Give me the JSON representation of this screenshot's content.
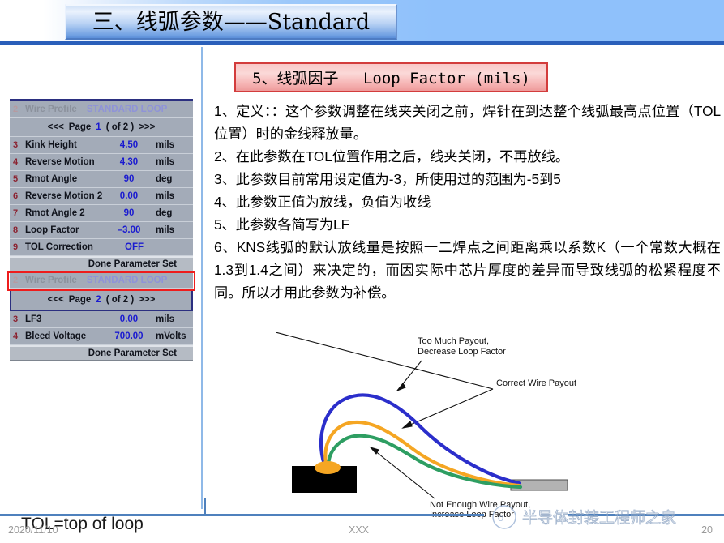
{
  "slide": {
    "title": "三、线弧参数——Standard",
    "subtitle": "5、线弧因子　 Loop Factor (mils)"
  },
  "wire_profile": {
    "page1": {
      "header": {
        "num": "2",
        "label": "Wire Profile",
        "value": "STANDARD LOOP"
      },
      "paging": {
        "prev": "<<<",
        "label": "Page",
        "page": "1",
        "of": "( of 2 )",
        "next": ">>>"
      },
      "rows": [
        {
          "num": "3",
          "label": "Kink Height",
          "value": "4.50",
          "unit": "mils"
        },
        {
          "num": "4",
          "label": "Reverse Motion",
          "value": "4.30",
          "unit": "mils"
        },
        {
          "num": "5",
          "label": "Rmot Angle",
          "value": "90",
          "unit": "deg"
        },
        {
          "num": "6",
          "label": "Reverse Motion 2",
          "value": "0.00",
          "unit": "mils"
        },
        {
          "num": "7",
          "label": "Rmot Angle 2",
          "value": "90",
          "unit": "deg"
        },
        {
          "num": "8",
          "label": "Loop Factor",
          "value": "–3.00",
          "unit": "mils"
        },
        {
          "num": "9",
          "label": "TOL Correction",
          "value": "OFF",
          "unit": ""
        }
      ],
      "done": "Done Parameter Set"
    },
    "page2": {
      "header": {
        "num": "2",
        "label": "Wire Profile",
        "value": "STANDARD LOOP"
      },
      "paging": {
        "prev": "<<<",
        "label": "Page",
        "page": "2",
        "of": "( of 2 )",
        "next": ">>>"
      },
      "rows": [
        {
          "num": "3",
          "label": "LF3",
          "value": "0.00",
          "unit": "mils"
        },
        {
          "num": "4",
          "label": "Bleed Voltage",
          "value": "700.00",
          "unit": "mVolts"
        }
      ],
      "done": "Done Parameter Set"
    },
    "highlight_color": "#ee1c1c"
  },
  "tol_note": "TOL=top of loop",
  "body": {
    "lines": [
      "1、定义：：这个参数调整在线夹关闭之前，焊针在到达整个线弧最高点位置（TOL位置）时的金线释放量。",
      "2、在此参数在TOL位置作用之后，线夹关闭，不再放线。",
      "3、此参数目前常用设定值为-3，所使用过的范围为-5到5",
      "4、此参数正值为放线，负值为收线",
      "5、此参数各简写为LF",
      "6、KNS线弧的默认放线量是按照一二焊点之间距离乘以系数K（一个常数大概在1.3到1.4之间）来决定的，而因实际中芯片厚度的差异而导致线弧的松紧程度不同。所以才用此参数为补偿。"
    ]
  },
  "diagram": {
    "annotations": {
      "too_much_line1": "Too Much Payout,",
      "too_much_line2": "Decrease Loop Factor",
      "correct": "Correct Wire Payout",
      "not_enough_line1": "Not Enough Wire Payout,",
      "not_enough_line2": "Increase Loop Factor"
    },
    "curves": {
      "too_much_color": "#2b2ecb",
      "correct_color": "#f5a623",
      "not_enough_color": "#2e9e62"
    },
    "die_color": "#000000",
    "lead_color": "#b3b3b3",
    "ball_color": "#f5a623"
  },
  "watermark": {
    "text": "半导体封装工程师之家"
  },
  "footer": {
    "date": "2020/11/10",
    "middle": "XXX",
    "page": "20"
  }
}
